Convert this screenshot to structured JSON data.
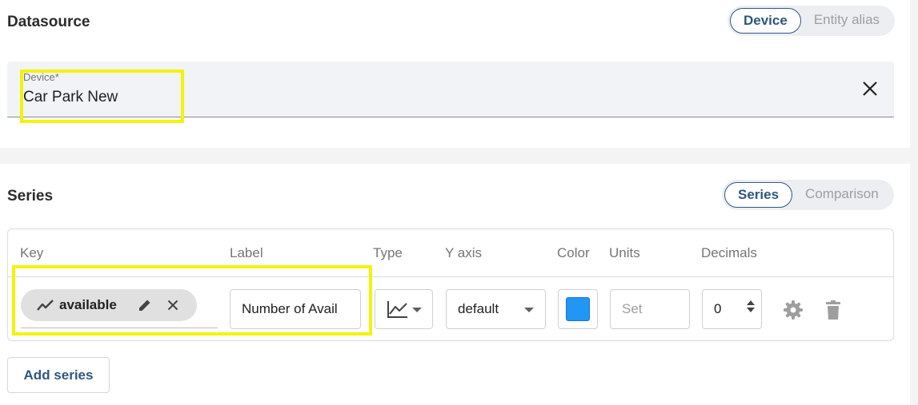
{
  "datasource": {
    "title": "Datasource",
    "toggle": {
      "active": "Device",
      "inactive": "Entity alias"
    },
    "device_field": {
      "label": "Device*",
      "value": "Car Park New"
    }
  },
  "series": {
    "title": "Series",
    "toggle": {
      "active": "Series",
      "inactive": "Comparison"
    },
    "columns": {
      "key": "Key",
      "label": "Label",
      "type": "Type",
      "y_axis": "Y axis",
      "color": "Color",
      "units": "Units",
      "decimals": "Decimals"
    },
    "rows": [
      {
        "key": "available",
        "label": "Number of Avail",
        "type_icon": "line-chart-icon",
        "y_axis": "default",
        "color": "#2196f3",
        "units_placeholder": "Set",
        "decimals": "0"
      }
    ],
    "add_button": "Add series"
  },
  "colors": {
    "accent": "#305680",
    "highlight": "#f3f30a"
  }
}
